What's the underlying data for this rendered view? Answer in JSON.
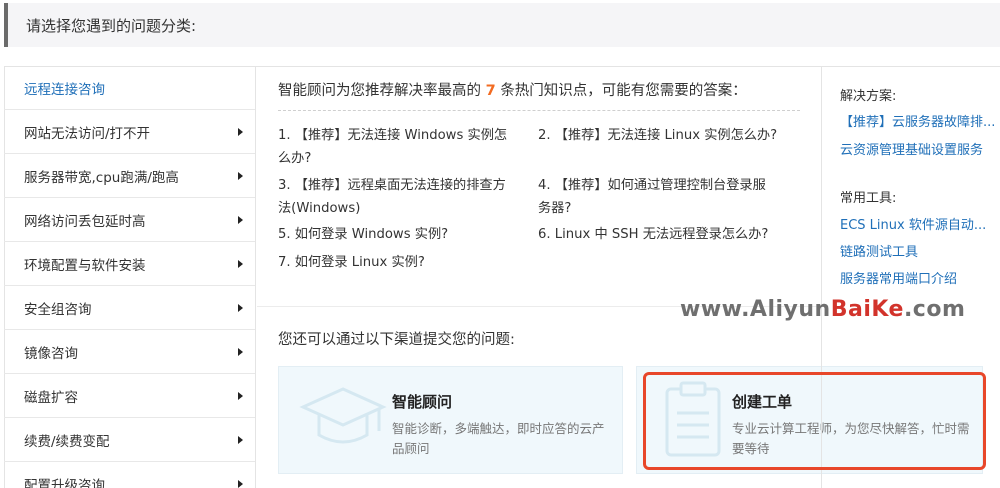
{
  "header": {
    "title": "请选择您遇到的问题分类:"
  },
  "sidebar": {
    "items": [
      {
        "label": "远程连接咨询"
      },
      {
        "label": "网站无法访问/打不开"
      },
      {
        "label": "服务器带宽,cpu跑满/跑高"
      },
      {
        "label": "网络访问丢包延时高"
      },
      {
        "label": "环境配置与软件安装"
      },
      {
        "label": "安全组咨询"
      },
      {
        "label": "镜像咨询"
      },
      {
        "label": "磁盘扩容"
      },
      {
        "label": "续费/续费变配"
      },
      {
        "label": "配置升级咨询"
      }
    ]
  },
  "main": {
    "recommend_prefix": "智能顾问为您推荐解决率最高的",
    "recommend_count": "7",
    "recommend_suffix": "条热门知识点，可能有您需要的答案：",
    "knowledge_points": [
      {
        "text": "1. 【推荐】无法连接 Windows 实例怎么办?"
      },
      {
        "text": "2. 【推荐】无法连接 Linux 实例怎么办?"
      },
      {
        "text": "3. 【推荐】远程桌面无法连接的排查方法(Windows)"
      },
      {
        "text": "4. 【推荐】如何通过管理控制台登录服务器?"
      },
      {
        "text": "5. 如何登录 Windows 实例?"
      },
      {
        "text": "6. Linux 中 SSH 无法远程登录怎么办?"
      },
      {
        "text": "7. 如何登录 Linux 实例?"
      }
    ],
    "channels_title": "您还可以通过以下渠道提交您的问题:",
    "cards": [
      {
        "title": "智能顾问",
        "desc": "智能诊断，多端触达，即时应答的云产品顾问"
      },
      {
        "title": "创建工单",
        "desc": "专业云计算工程师，为您尽快解答，忙时需要等待"
      }
    ]
  },
  "right": {
    "solutions_label": "解决方案:",
    "solutions": [
      {
        "label": "【推荐】云服务器故障排..."
      },
      {
        "label": "云资源管理基础设置服务"
      }
    ],
    "tools_label": "常用工具:",
    "tools": [
      {
        "label": "ECS Linux 软件源自动..."
      },
      {
        "label": "链路测试工具"
      },
      {
        "label": "服务器常用端口介绍"
      }
    ]
  },
  "watermark": {
    "prefix": "www.Aliyun",
    "mid": "BaiKe",
    "suffix": ".com"
  },
  "colors": {
    "link": "#1f6fb8",
    "accent": "#f26b22",
    "highlight": "#e8472a"
  }
}
